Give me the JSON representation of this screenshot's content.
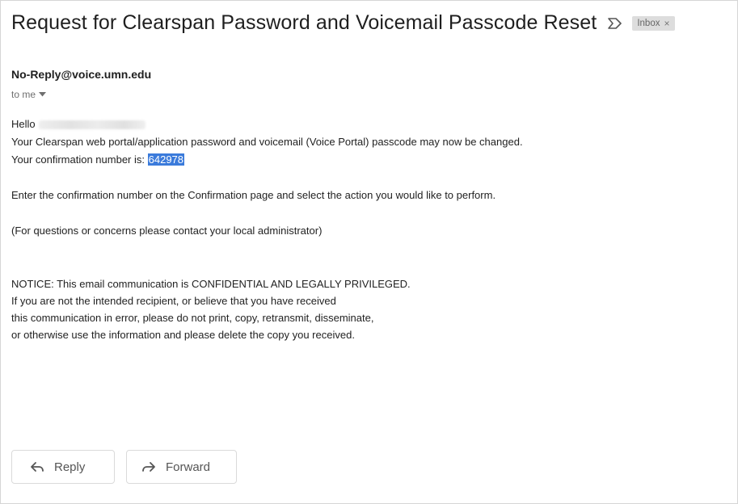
{
  "email": {
    "subject": "Request for Clearspan Password and Voicemail Passcode Reset",
    "label": "Inbox",
    "label_close": "×",
    "sender": "No-Reply@voice.umn.edu",
    "to": "to me",
    "greeting": "Hello",
    "body_line1": "Your Clearspan web portal/application password and voicemail (Voice Portal) passcode may now be changed.",
    "confirmation_prefix": "Your confirmation number is:",
    "confirmation_number": "642978",
    "instruction": "Enter the confirmation number on the Confirmation page and select the action you would like to perform.",
    "questions": "(For questions or concerns please contact your local administrator)",
    "notice": [
      "NOTICE: This email communication is CONFIDENTIAL AND LEGALLY PRIVILEGED.",
      "If you are not the intended recipient, or believe that you have received",
      "this communication in error, please do not print, copy, retransmit, disseminate,",
      "or otherwise use the information and please delete the copy you received."
    ]
  },
  "actions": {
    "reply_label": "Reply",
    "forward_label": "Forward"
  },
  "icons": {
    "importance": "importance-marker-icon",
    "to_dropdown": "chevron-down-icon",
    "reply": "reply-arrow-icon",
    "forward": "forward-arrow-icon"
  },
  "colors": {
    "highlight": "#3b7bdb",
    "label_bg": "#dddddd"
  }
}
